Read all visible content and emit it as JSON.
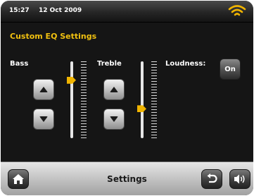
{
  "status_bar": {
    "time": "15:27",
    "date": "12 Oct  2009",
    "wifi_icon": "wifi-icon"
  },
  "page": {
    "title": "Custom EQ Settings"
  },
  "bass": {
    "label": "Bass",
    "level": 0.78
  },
  "treble": {
    "label": "Treble",
    "level": 0.37
  },
  "loudness": {
    "label": "Loudness:",
    "button_label": "On"
  },
  "footer": {
    "title": "Settings"
  },
  "icons": {
    "home": "home-icon",
    "back": "back-icon",
    "volume": "volume-icon",
    "up": "up-arrow-icon",
    "down": "down-arrow-icon"
  },
  "colors": {
    "accent": "#f0c010",
    "slider_knob": "#f0b400",
    "background": "#151515"
  }
}
